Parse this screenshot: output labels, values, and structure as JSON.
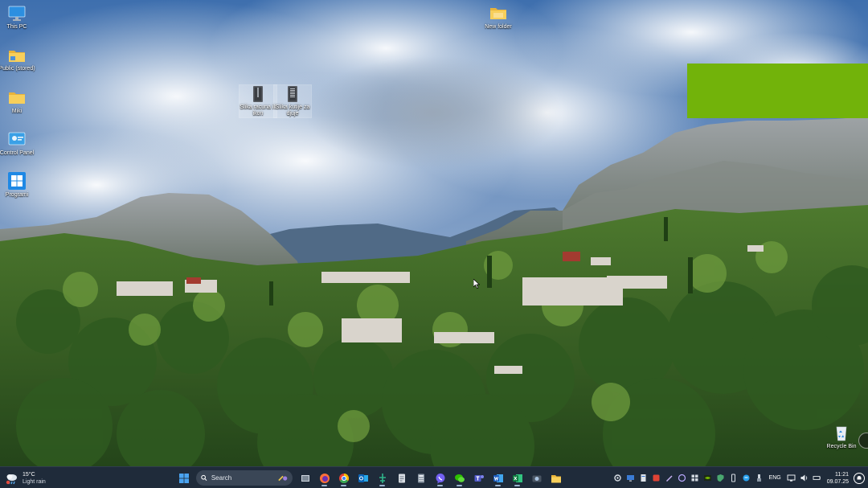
{
  "desktop": {
    "icons": [
      {
        "label": "This PC",
        "icon": "monitor-icon"
      },
      {
        "label": "Public (stored)",
        "icon": "folder-icon"
      },
      {
        "label": "Miki",
        "icon": "folder-icon"
      },
      {
        "label": "Control Panel",
        "icon": "control-panel-icon"
      },
      {
        "label": "Programi",
        "icon": "windows-logo-icon"
      },
      {
        "label": "New folder",
        "icon": "folder-icon"
      },
      {
        "label": "Slika racuna ili ikon",
        "icon": "archive-file-icon"
      },
      {
        "label": "Slika kutije za djuje",
        "icon": "archive-file-icon"
      },
      {
        "label": "Recycle Bin",
        "icon": "recycle-bin-icon"
      }
    ]
  },
  "overlay": {
    "color": "#72b30a"
  },
  "taskbar": {
    "weather": {
      "temperature": "15°C",
      "condition": "Light rain",
      "icon": "weather-rain-icon"
    },
    "search": {
      "placeholder": "Search"
    },
    "apps": [
      "start-button",
      "task-view-icon",
      "firefox-icon",
      "chrome-icon",
      "outlook-icon",
      "app-icon",
      "notepad-icon",
      "calculator-icon",
      "viber-icon",
      "wechat-icon",
      "teams-icon",
      "word-icon",
      "excel-icon",
      "camera-icon",
      "file-explorer-icon"
    ],
    "tray": {
      "language": "ENG",
      "time": "11:21",
      "date": "09.07.25"
    }
  },
  "colors": {
    "taskbar_bg": "#1f2b3a",
    "accent_green": "#72b30a",
    "folder_yellow": "#f2c94c"
  }
}
